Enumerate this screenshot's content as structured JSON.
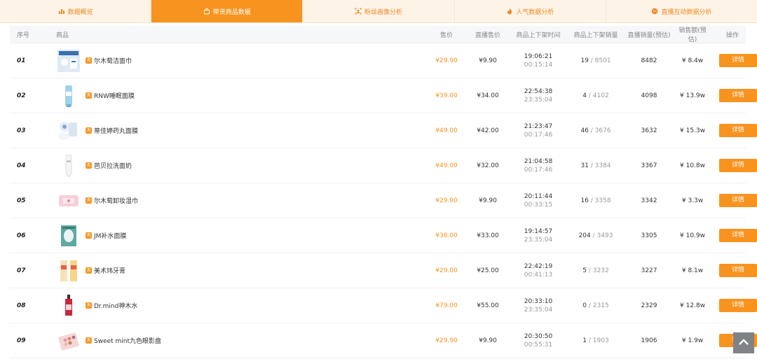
{
  "tabs": [
    {
      "label": "数据概览",
      "icon": "bar-chart-icon",
      "active": false
    },
    {
      "label": "带货商品数据",
      "icon": "shopping-bag-icon",
      "active": true
    },
    {
      "label": "粉丝画像分析",
      "icon": "user-portrait-icon",
      "active": false
    },
    {
      "label": "人气数据分析",
      "icon": "fire-icon",
      "active": false
    },
    {
      "label": "直播互动数据分析",
      "icon": "interaction-icon",
      "active": false
    }
  ],
  "table": {
    "headers": {
      "index": "序号",
      "product": "商品",
      "price": "售价",
      "live_price": "直播售价",
      "shelf_time": "商品上下架时间",
      "shelf_sales": "商品上下架销量",
      "live_sales": "直播销量(预估)",
      "amount": "销售额(预估)",
      "operation": "操作"
    },
    "rows": [
      {
        "index": "01",
        "name": "尔木萄洁面巾",
        "price": "¥29.90",
        "live_price": "¥9.90",
        "time_on": "19:06:21",
        "time_dur": "00:15:14",
        "shelf_a": "19",
        "shelf_b": "8501",
        "live_sales": "8482",
        "amount": "¥ 8.4w",
        "btn": "详情",
        "thumb": "face-towel"
      },
      {
        "index": "02",
        "name": "RNW睡眠面膜",
        "price": "¥39.00",
        "live_price": "¥34.00",
        "time_on": "22:54:38",
        "time_dur": "23:35:04",
        "shelf_a": "4",
        "shelf_b": "4102",
        "live_sales": "4098",
        "amount": "¥ 13.9w",
        "btn": "详情",
        "thumb": "blue-tube"
      },
      {
        "index": "03",
        "name": "蒂佳婷药丸面膜",
        "price": "¥49.00",
        "live_price": "¥42.00",
        "time_on": "21:23:47",
        "time_dur": "00:17:46",
        "shelf_a": "46",
        "shelf_b": "3676",
        "live_sales": "3632",
        "amount": "¥ 15.3w",
        "btn": "详情",
        "thumb": "pill-mask"
      },
      {
        "index": "04",
        "name": "芭贝拉洗面奶",
        "price": "¥49.00",
        "live_price": "¥32.00",
        "time_on": "21:04:58",
        "time_dur": "00:17:46",
        "shelf_a": "31",
        "shelf_b": "3384",
        "live_sales": "3367",
        "amount": "¥ 10.8w",
        "btn": "详情",
        "thumb": "white-tube"
      },
      {
        "index": "05",
        "name": "尔木萄卸妆湿巾",
        "price": "¥29.90",
        "live_price": "¥9.90",
        "time_on": "20:11:44",
        "time_dur": "00:33:15",
        "shelf_a": "16",
        "shelf_b": "3358",
        "live_sales": "3342",
        "amount": "¥ 3.3w",
        "btn": "详情",
        "thumb": "pink-pack"
      },
      {
        "index": "06",
        "name": "JM补水面膜",
        "price": "¥38.00",
        "live_price": "¥33.00",
        "time_on": "19:14:57",
        "time_dur": "23:35:04",
        "shelf_a": "204",
        "shelf_b": "3493",
        "live_sales": "3305",
        "amount": "¥ 10.9w",
        "btn": "详情",
        "thumb": "green-box"
      },
      {
        "index": "07",
        "name": "美术玮牙膏",
        "price": "¥29.00",
        "live_price": "¥25.00",
        "time_on": "22:42:19",
        "time_dur": "00:41:13",
        "shelf_a": "5",
        "shelf_b": "3232",
        "live_sales": "3227",
        "amount": "¥ 8.1w",
        "btn": "详情",
        "thumb": "toothpaste"
      },
      {
        "index": "08",
        "name": "Dr.mind神木水",
        "price": "¥79.00",
        "live_price": "¥55.00",
        "time_on": "20:33:10",
        "time_dur": "23:35:04",
        "shelf_a": "0",
        "shelf_b": "2315",
        "live_sales": "2329",
        "amount": "¥ 12.8w",
        "btn": "详情",
        "thumb": "red-bottle"
      },
      {
        "index": "09",
        "name": "Sweet mint九色眼影盘",
        "price": "¥29.90",
        "live_price": "¥9.90",
        "time_on": "20:30:50",
        "time_dur": "00:55:31",
        "shelf_a": "1",
        "shelf_b": "1903",
        "live_sales": "1906",
        "amount": "¥ 1.9w",
        "btn": "详情",
        "thumb": "eyeshadow"
      }
    ]
  },
  "badge_label": "天",
  "back_to_top_icon": "chevron-up-icon",
  "colors": {
    "accent": "#f7931e",
    "tab_bg": "#fdf3e6"
  }
}
